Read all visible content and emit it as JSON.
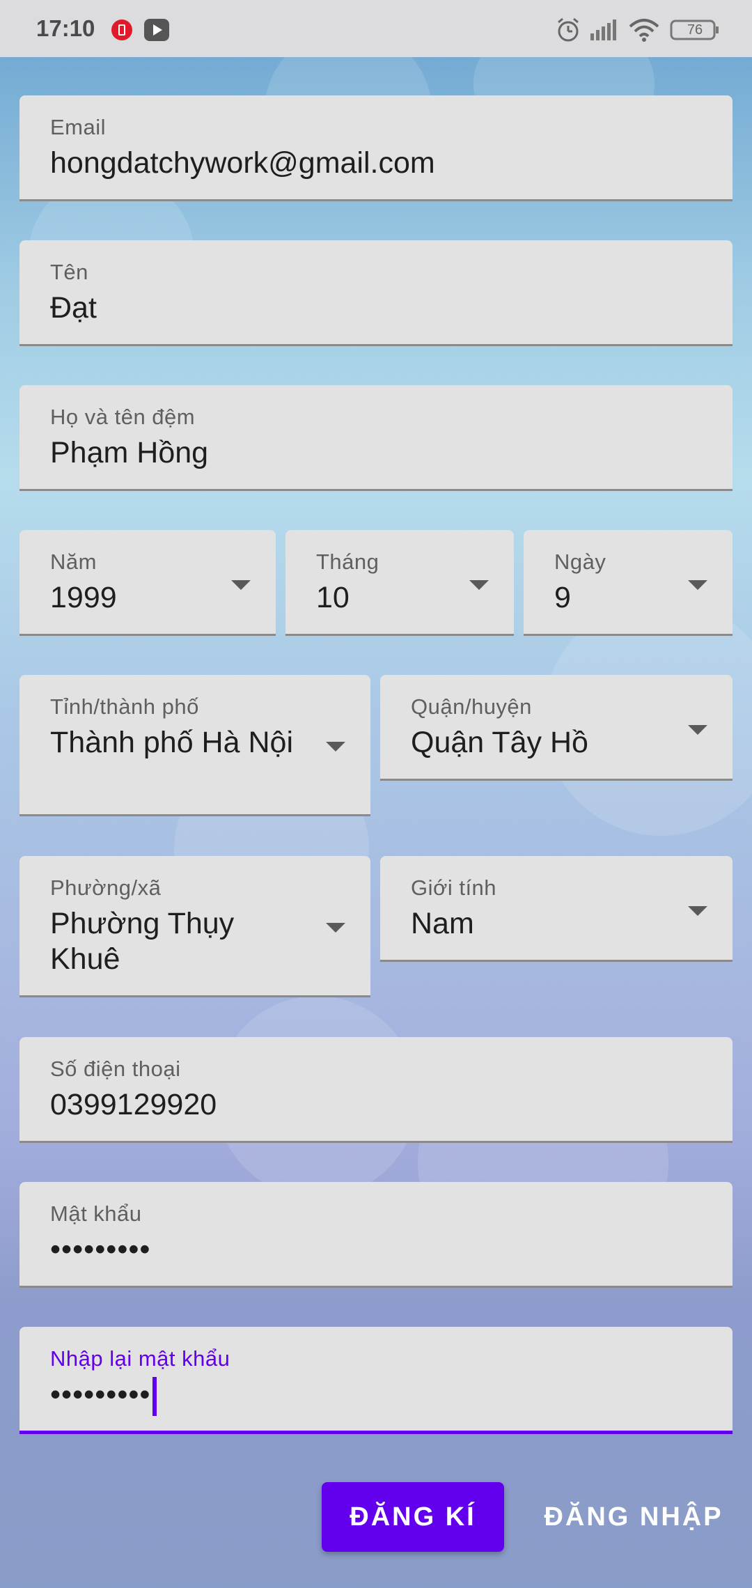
{
  "status_bar": {
    "time": "17:10",
    "battery": "76",
    "icons": [
      "app-notification-icon",
      "youtube-icon",
      "alarm-icon",
      "signal-icon",
      "wifi-icon",
      "battery-icon"
    ]
  },
  "form": {
    "email": {
      "label": "Email",
      "value": "hongdatchywork@gmail.com"
    },
    "first_name": {
      "label": "Tên",
      "value": "Đạt"
    },
    "last_name": {
      "label": "Họ và tên đệm",
      "value": "Phạm Hồng"
    },
    "year": {
      "label": "Năm",
      "value": "1999"
    },
    "month": {
      "label": "Tháng",
      "value": "10"
    },
    "day": {
      "label": "Ngày",
      "value": "9"
    },
    "province": {
      "label": "Tỉnh/thành phố",
      "value": "Thành phố Hà Nội"
    },
    "district": {
      "label": "Quận/huyện",
      "value": "Quận Tây Hồ"
    },
    "ward": {
      "label": "Phường/xã",
      "value": "Phường Thụy Khuê"
    },
    "gender": {
      "label": "Giới tính",
      "value": "Nam"
    },
    "phone": {
      "label": "Số điện thoại",
      "value": "0399129920"
    },
    "password": {
      "label": "Mật khẩu",
      "value": "•••••••••"
    },
    "confirm_password": {
      "label": "Nhập lại mật khẩu",
      "value": "•••••••••"
    }
  },
  "actions": {
    "register": "ĐĂNG KÍ",
    "login": "ĐĂNG NHẬP"
  },
  "colors": {
    "accent": "#6200ee",
    "field_bg": "#e2e2e2"
  }
}
